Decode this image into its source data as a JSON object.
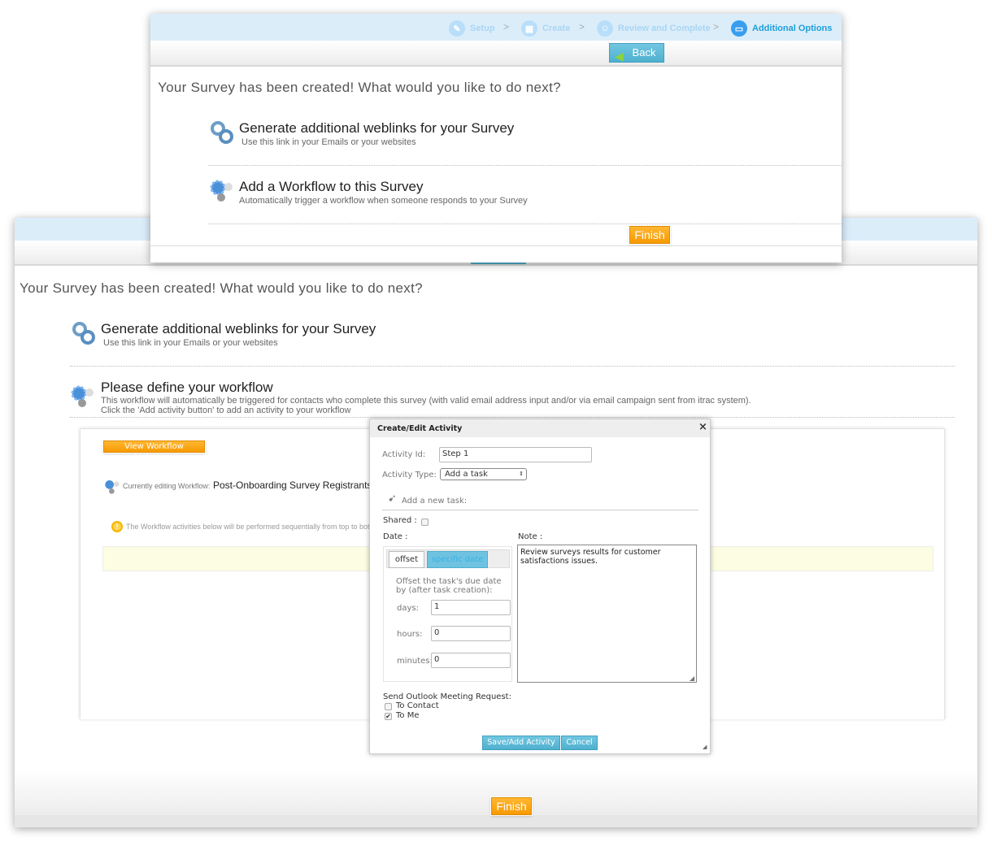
{
  "wizard": {
    "steps": [
      {
        "label": "Setup",
        "icon": "edit-icon",
        "state": "done"
      },
      {
        "label": "Create",
        "icon": "grid-icon",
        "state": "done"
      },
      {
        "label": "Review and Complete",
        "icon": "user-icon",
        "state": "done"
      },
      {
        "label": "Additional Options",
        "icon": "briefcase-icon",
        "state": "active"
      }
    ],
    "separator": ">"
  },
  "front": {
    "back_label": "Back",
    "lead": "Your Survey has been created! What would you like to do next?",
    "options": [
      {
        "title": "Generate additional weblinks for your Survey",
        "subtitle": "Use this link in your Emails or your websites",
        "icon": "chain-link-icon"
      },
      {
        "title": "Add a Workflow to this Survey",
        "subtitle": "Automatically trigger a workflow when someone responds to your Survey",
        "icon": "gears-icon"
      }
    ],
    "finish_label": "Finish"
  },
  "back": {
    "lead": "Your Survey has been created! What would you like to do next?",
    "weblinks": {
      "title": "Generate additional weblinks for your Survey",
      "subtitle": "Use this link in your Emails or your websites"
    },
    "workflow": {
      "title": "Please define your workflow",
      "line1": "This workflow will automatically be triggered for contacts who complete this survey (with valid email address input and/or via email campaign sent from itrac system).",
      "line2": "Click the 'Add activity button' to add an activity to your workflow"
    },
    "view_instances_label": "View Workflow Instances",
    "editing_label": "Currently editing Workflow:",
    "workflow_name": "Post-Onboarding Survey Registrants W",
    "info_text": "The Workflow activities below will be performed sequentially from top to bot",
    "finish_label": "Finish"
  },
  "dialog": {
    "title": "Create/Edit Activity",
    "close": "×",
    "activity_id_label": "Activity Id:",
    "activity_id_value": "Step 1",
    "activity_type_label": "Activity Type:",
    "activity_type_value": "Add a task",
    "section_label": "Add a new task:",
    "shared_label": "Shared :",
    "shared_checked": false,
    "date_label": "Date :",
    "note_label": "Note :",
    "tabs": [
      "offset",
      "specific date"
    ],
    "active_tab": "offset",
    "offset_desc": "Offset the task's due date by (after task creation):",
    "days_label": "days:",
    "days_value": "1",
    "hours_label": "hours:",
    "hours_value": "0",
    "minutes_label": "minutes:",
    "minutes_value": "0",
    "note_value": "Review surveys results for customer satisfactions issues.",
    "outlook_label": "Send Outlook Meeting Request:",
    "to_contact_label": "To Contact",
    "to_contact_checked": false,
    "to_me_label": "To Me",
    "to_me_checked": true,
    "save_label": "Save/Add Activity",
    "cancel_label": "Cancel"
  },
  "colors": {
    "accent_blue": "#4eb0cf",
    "orange": "#f79a00",
    "header_band": "#dcedfa",
    "info_yellow": "#fdfde3"
  }
}
